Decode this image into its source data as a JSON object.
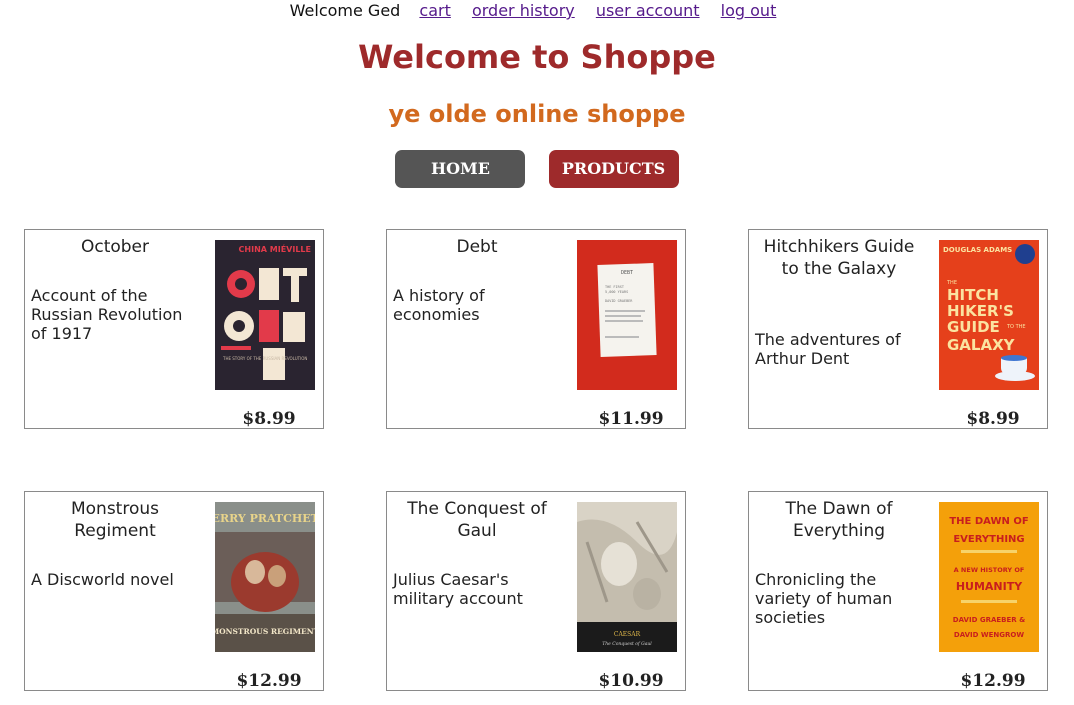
{
  "topbar": {
    "welcome": "Welcome Ged",
    "links": [
      "cart",
      "order history",
      "user account",
      "log out"
    ]
  },
  "header": {
    "title": "Welcome to Shoppe",
    "subtitle": "ye olde online shoppe"
  },
  "nav": {
    "home": "HOME",
    "products": "PRODUCTS"
  },
  "products": [
    {
      "name": "October",
      "description": "Account of the Russian Revolution of 1917",
      "price": "$8.99",
      "cover": {
        "top": "CHINA MIÉVILLE",
        "letters": [
          "OCT",
          "OBER"
        ],
        "foot": "THE STORY OF THE RUSSIAN REVOLUTION"
      }
    },
    {
      "name": "Debt",
      "description": "A history of economies",
      "price": "$11.99",
      "cover": {
        "top": "DEBT",
        "lines": [
          "THE FIRST",
          "5,000 YEARS",
          "DAVID GRAEBER"
        ]
      }
    },
    {
      "name": "Hitchhikers Guide to the Galaxy",
      "description": "The adventures of Arthur Dent",
      "price": "$8.99",
      "cover": {
        "top": "DOUGLAS ADAMS",
        "lines": [
          "THE",
          "HITCH",
          "HIKER'S",
          "GUIDE",
          "TO THE",
          "GALAXY"
        ]
      }
    },
    {
      "name": "Monstrous Regiment",
      "description": "A Discworld novel",
      "price": "$12.99",
      "cover": {
        "top": "TERRY PRATCHETT",
        "title": "MONSTROUS REGIMENT"
      }
    },
    {
      "name": "The Conquest of Gaul",
      "description": "Julius Caesar's military account",
      "price": "$10.99",
      "cover": {
        "author": "CAESAR",
        "title": "The Conquest of Gaul"
      }
    },
    {
      "name": "The Dawn of Everything",
      "description": "Chronicling the variety of human societies",
      "price": "$12.99",
      "cover": {
        "lines": [
          "THE DAWN OF",
          "EVERYTHING",
          "A NEW HISTORY OF",
          "HUMANITY",
          "DAVID GRAEBER &",
          "DAVID WENGROW"
        ]
      }
    }
  ],
  "colors": {
    "title": "#9e2a2b",
    "subtitle": "#d2691e",
    "home_button": "#555555",
    "products_button": "#9e2a2b",
    "link": "#551a8b"
  }
}
